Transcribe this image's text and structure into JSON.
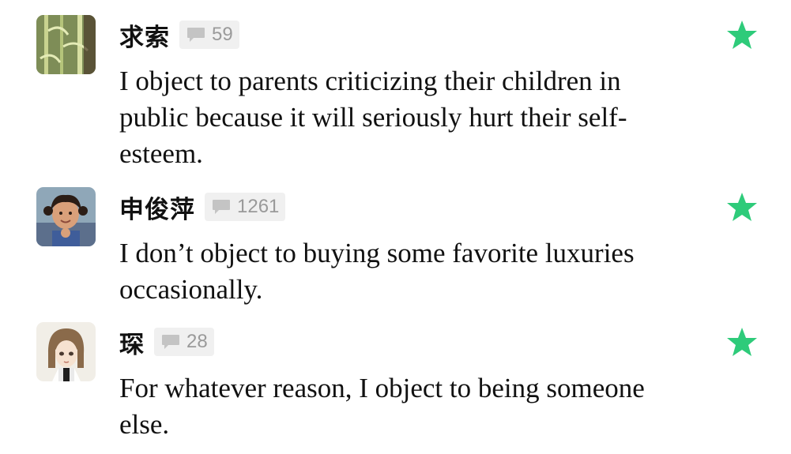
{
  "comments": [
    {
      "username": "求索",
      "comment_count": "59",
      "text": "I object to parents criticizing their children in public because it will seriously hurt their self-esteem.",
      "avatar": "bamboo-avatar",
      "starred": true
    },
    {
      "username": "申俊萍",
      "comment_count": "1261",
      "text": "I don’t object to buying some favorite luxuries occasionally.",
      "avatar": "girl-photo-avatar",
      "starred": true
    },
    {
      "username": "琛",
      "comment_count": "28",
      "text": "For whatever reason, I object to being someone else.",
      "avatar": "illustrated-girl-avatar",
      "starred": true
    }
  ],
  "icons": {
    "comment": "comment-bubble-icon",
    "star": "star-icon"
  },
  "colors": {
    "star": "#2ecb7a",
    "badge_bg": "#f0f0f0",
    "badge_text": "#9a9a9a",
    "text": "#111111"
  }
}
